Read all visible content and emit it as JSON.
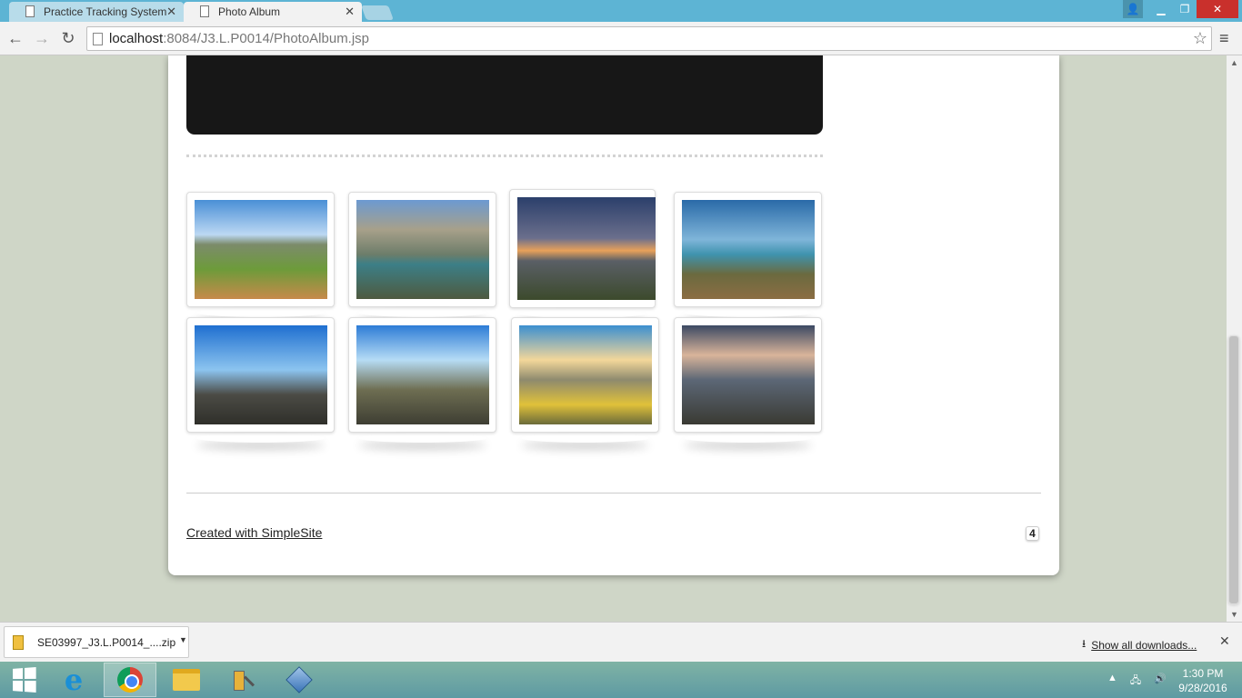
{
  "browser": {
    "tabs": [
      {
        "title": "Practice Tracking System"
      },
      {
        "title": "Photo Album"
      }
    ],
    "url_host": "localhost",
    "url_rest": ":8084/J3.L.P0014/PhotoAlbum.jsp",
    "icons": {
      "back": "back-icon",
      "forward": "forward-icon",
      "reload": "reload-icon",
      "star": "star-icon",
      "menu": "menu-icon"
    }
  },
  "page": {
    "gallery": [
      {
        "alt": "hiker resting on grass"
      },
      {
        "alt": "hikers near mountain lake"
      },
      {
        "alt": "campfire at sunset"
      },
      {
        "alt": "hikers by alpine lake"
      },
      {
        "alt": "hikers on rocky ridge"
      },
      {
        "alt": "hiker climbing in sun"
      },
      {
        "alt": "yellow tent at sunrise"
      },
      {
        "alt": "backpacker at sunset"
      }
    ],
    "credit_link": "Created with SimpleSite",
    "badge": "4"
  },
  "downloads": {
    "file_name": "SE03997_J3.L.P0014_....zip",
    "show_all": "Show all downloads..."
  },
  "taskbar": {
    "time": "1:30 PM",
    "date": "9/28/2016"
  }
}
